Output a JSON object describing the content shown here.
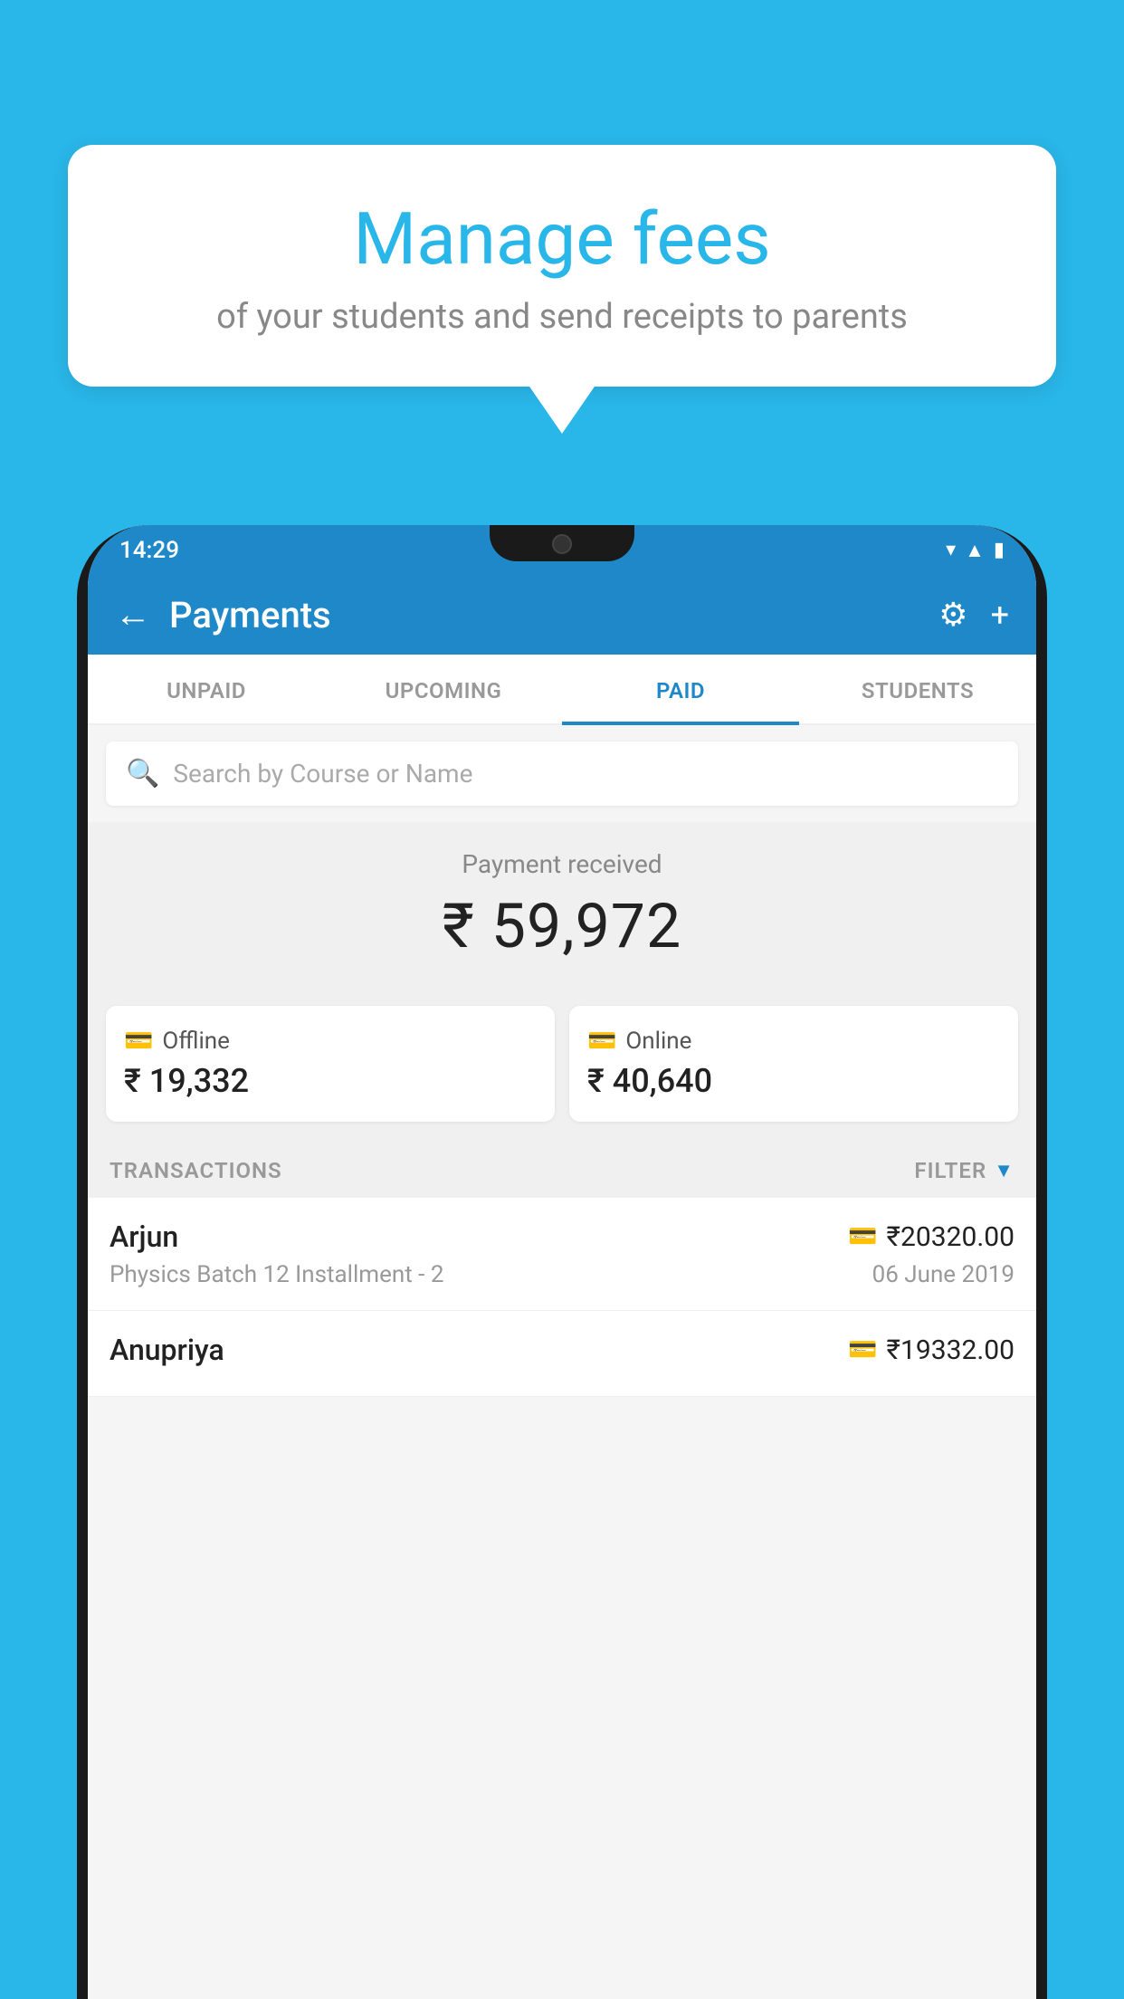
{
  "background_color": "#29b6e8",
  "speech_bubble": {
    "title": "Manage fees",
    "subtitle": "of your students and send receipts to parents"
  },
  "status_bar": {
    "time": "14:29",
    "icons": [
      "wifi",
      "signal",
      "battery"
    ]
  },
  "header": {
    "title": "Payments",
    "back_label": "←",
    "settings_label": "⚙",
    "add_label": "+"
  },
  "tabs": [
    {
      "label": "UNPAID",
      "active": false
    },
    {
      "label": "UPCOMING",
      "active": false
    },
    {
      "label": "PAID",
      "active": true
    },
    {
      "label": "STUDENTS",
      "active": false
    }
  ],
  "search": {
    "placeholder": "Search by Course or Name"
  },
  "payment_received": {
    "label": "Payment received",
    "amount": "₹ 59,972"
  },
  "payment_cards": [
    {
      "type": "Offline",
      "amount": "₹ 19,332",
      "icon": "💳"
    },
    {
      "type": "Online",
      "amount": "₹ 40,640",
      "icon": "💳"
    }
  ],
  "transactions_section": {
    "label": "TRANSACTIONS",
    "filter_label": "FILTER"
  },
  "transactions": [
    {
      "name": "Arjun",
      "course": "Physics Batch 12 Installment - 2",
      "amount": "₹20320.00",
      "date": "06 June 2019",
      "payment_type": "card"
    },
    {
      "name": "Anupriya",
      "course": "",
      "amount": "₹19332.00",
      "date": "",
      "payment_type": "cash"
    }
  ]
}
